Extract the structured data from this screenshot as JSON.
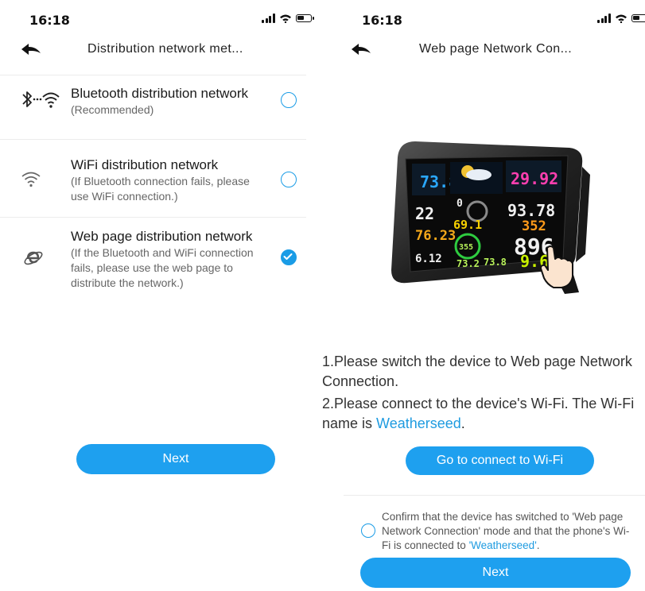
{
  "left": {
    "status": {
      "time": "16:18"
    },
    "nav": {
      "title": "Distribution network met..."
    },
    "options": [
      {
        "icon": "bluetooth-wifi-icon",
        "title": "Bluetooth distribution network",
        "subtitle": "(Recommended)",
        "selected": false
      },
      {
        "icon": "wifi-icon",
        "title": "WiFi distribution network",
        "subtitle": "(If Bluetooth connection fails, please use WiFi connection.)",
        "selected": false
      },
      {
        "icon": "web-browser-icon",
        "title": "Web page distribution network",
        "subtitle": "(If the Bluetooth and WiFi connection fails, please use the web page to distribute the network.)",
        "selected": true
      }
    ],
    "next_label": "Next"
  },
  "right": {
    "status": {
      "time": "16:18"
    },
    "nav": {
      "title": "Web page Network Con..."
    },
    "device_readings": {
      "r1": "73.8",
      "r2": "29.92",
      "r3": "22",
      "r4": "0",
      "r5": "93.78",
      "r6": "69.1",
      "r7": "352",
      "r8": "76.23",
      "r9": "355",
      "r10": "896",
      "r11": "6.12",
      "r12": "73.2",
      "r13": "73.8",
      "r14": "9.6"
    },
    "instructions": {
      "step1": "1.Please switch the device to Web page Network Connection.",
      "step2_prefix": "2.Please connect to the device's Wi-Fi. The Wi-Fi name is ",
      "wifi_name": "Weatherseed",
      "step2_suffix": "."
    },
    "connect_wifi_label": "Go to connect to Wi-Fi",
    "confirm": {
      "text_prefix": "Confirm that the device has switched to 'Web page Network Connection' mode and that the phone's Wi-Fi is connected to ",
      "wifi_name": "'Weatherseed'",
      "text_suffix": ".",
      "checked": false
    },
    "next_label": "Next"
  },
  "colors": {
    "accent": "#1ea0ef",
    "link": "#1e9be0",
    "separator": "#ececec"
  }
}
